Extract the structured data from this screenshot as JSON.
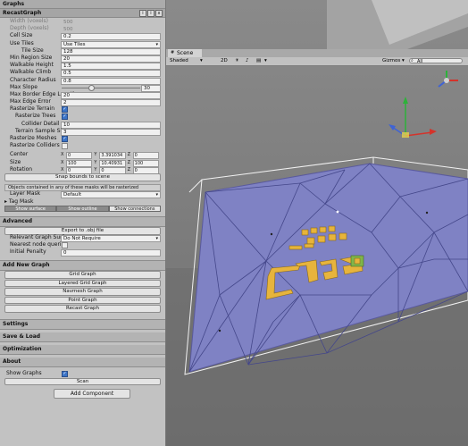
{
  "graphs_header": "Graphs",
  "graph_name": "RecastGraph",
  "graph_icons": [
    "i",
    "i",
    "x"
  ],
  "ro_fields": [
    {
      "label": "Width (voxels)",
      "value": "500"
    },
    {
      "label": "Depth (voxels)",
      "value": "500"
    }
  ],
  "cell_size": {
    "label": "Cell Size",
    "value": "0.2"
  },
  "use_tiles": {
    "label": "Use Tiles",
    "value": "Use Tiles"
  },
  "tile_size": {
    "label": "Tile Size",
    "value": "128"
  },
  "params": [
    {
      "label": "Min Region Size",
      "value": "20"
    },
    {
      "label": "Walkable Height",
      "value": "1.5"
    },
    {
      "label": "Walkable Climb",
      "value": "0.5"
    },
    {
      "label": "Character Radius",
      "value": "0.8"
    }
  ],
  "max_slope": {
    "label": "Max Slope",
    "value": "30"
  },
  "params2": [
    {
      "label": "Max Border Edge Length",
      "value": "20"
    },
    {
      "label": "Max Edge Error",
      "value": "2"
    }
  ],
  "rasterize_terrain": {
    "label": "Rasterize Terrain",
    "checked": true
  },
  "rasterize_trees": {
    "label": "Rasterize Trees",
    "checked": true
  },
  "collider_detail": {
    "label": "Collider Detail",
    "value": "10"
  },
  "terrain_sample_size": {
    "label": "Terrain Sample Size",
    "value": "3"
  },
  "rasterize_meshes": {
    "label": "Rasterize Meshes",
    "checked": true
  },
  "rasterize_colliders": {
    "label": "Rasterize Colliders",
    "checked": false
  },
  "center": {
    "label": "Center",
    "x": "0",
    "y": "3.391034",
    "z": "0"
  },
  "size": {
    "label": "Size",
    "x": "100",
    "y": "10.40931",
    "z": "100"
  },
  "rotation": {
    "label": "Rotation",
    "x": "0",
    "y": "0",
    "z": "0"
  },
  "snap_button": "Snap bounds to scene",
  "mask_note": "Objects contained in any of these masks will be rasterized",
  "layer_mask": {
    "label": "Layer Mask",
    "value": "Default"
  },
  "tag_mask": "Tag Mask",
  "view_tabs": [
    "Show surface",
    "Show outline",
    "Show connections"
  ],
  "advanced_header": "Advanced",
  "export_button": "Export to .obj file",
  "relevant_surface": {
    "label": "Relevant Graph Surface",
    "value": "Do Not Require"
  },
  "nearest_node": {
    "label": "Nearest node queries",
    "checked": false
  },
  "initial_penalty": {
    "label": "Initial Penalty",
    "value": "0"
  },
  "add_graph_header": "Add New Graph",
  "graph_buttons": [
    "Grid Graph",
    "Layered Grid Graph",
    "Navmesh Graph",
    "Point Graph",
    "Recast Graph"
  ],
  "folds": [
    "Settings",
    "Save & Load",
    "Optimization",
    "About"
  ],
  "show_graphs": {
    "label": "Show Graphs",
    "checked": true
  },
  "scan_button": "Scan",
  "add_component_button": "Add Component",
  "scene_tab": "Scene",
  "scene_toolbar": {
    "shading": "Shaded",
    "mode": "2D",
    "gizmos": "Gizmos",
    "search": "All"
  },
  "colors": {
    "navmesh": "#7f82c4",
    "sky_upper": "#8a8a8a",
    "ground": "#6a6a6a",
    "obstacles": "#e7b43c"
  }
}
